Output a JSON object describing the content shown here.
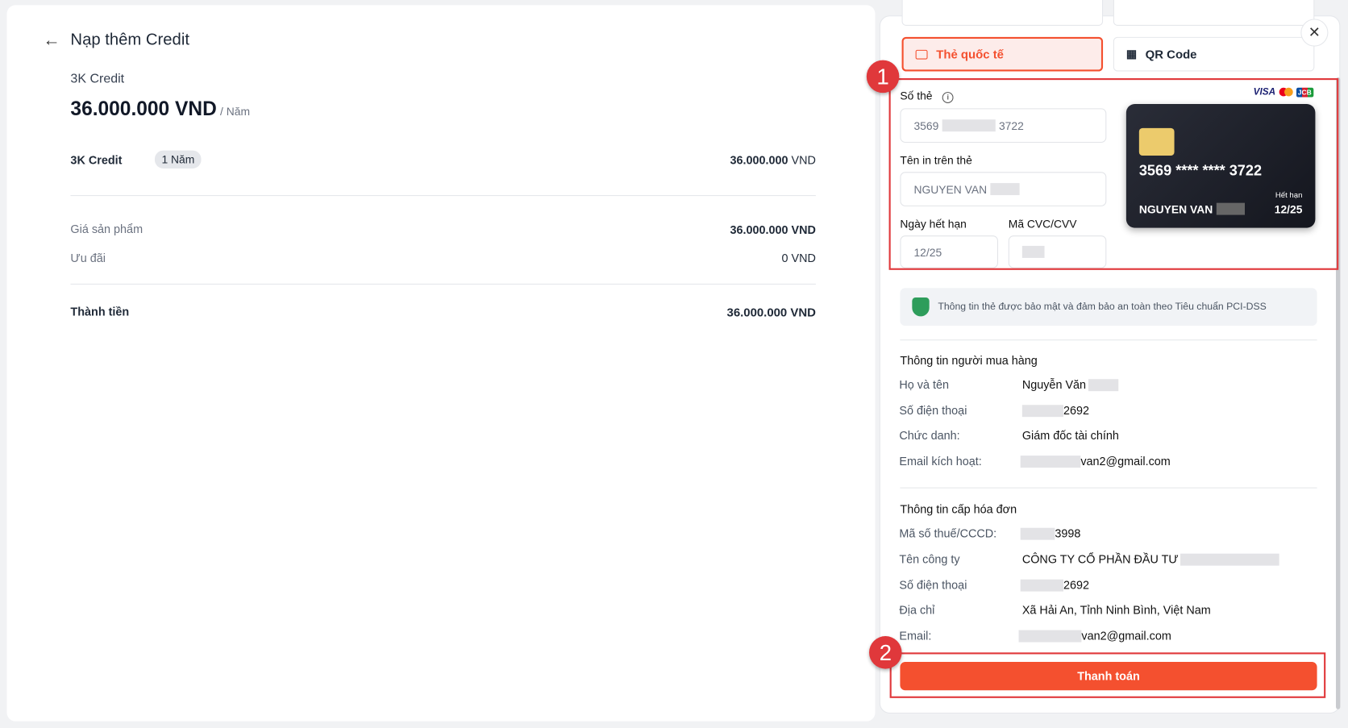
{
  "header": {
    "title": "Nạp thêm Credit"
  },
  "product": {
    "name": "3K Credit",
    "price": "36.000.000 VND",
    "period": "/ Năm"
  },
  "line_item": {
    "name": "3K Credit",
    "duration": "1 Năm",
    "amount": "36.000.000",
    "currency": "VND"
  },
  "summary": {
    "product_price_label": "Giá sản phẩm",
    "product_price": "36.000.000 VND",
    "discount_label": "Ưu đãi",
    "discount": "0 VND",
    "total_label": "Thành tiền",
    "total": "36.000.000 VND"
  },
  "payment": {
    "tabs": [
      {
        "label": "Thẻ quốc tế",
        "active": true
      },
      {
        "label": "QR Code",
        "active": false
      }
    ],
    "card_number_label": "Số thẻ",
    "card_number_start": "3569",
    "card_number_end": "3722",
    "name_label": "Tên in trên thẻ",
    "name_value": "NGUYEN VAN",
    "expiry_label": "Ngày hết hạn",
    "expiry_value": "12/25",
    "cvc_label": "Mã CVC/CVV",
    "brands": [
      "VISA",
      "mastercard",
      "JCB"
    ],
    "card_preview": {
      "number": "3569 **** **** 3722",
      "holder": "NGUYEN VAN",
      "expiry_label": "Hết hạn",
      "expiry": "12/25"
    },
    "security_note": "Thông tin thẻ được bảo mật và đảm bảo an toàn theo Tiêu chuẩn PCI-DSS"
  },
  "buyer": {
    "title": "Thông tin người mua hàng",
    "rows": [
      {
        "label": "Họ và tên",
        "value": "Nguyễn Văn"
      },
      {
        "label": "Số điện thoại",
        "value": "2692"
      },
      {
        "label": "Chức danh:",
        "value": "Giám đốc tài chính"
      },
      {
        "label": "Email kích hoạt:",
        "value": "van2@gmail.com"
      }
    ]
  },
  "invoice": {
    "title": "Thông tin cấp hóa đơn",
    "rows": [
      {
        "label": "Mã số thuế/CCCD:",
        "value": "3998"
      },
      {
        "label": "Tên công ty",
        "value": "CÔNG TY CỔ PHẦN ĐẦU TƯ"
      },
      {
        "label": "Số điện thoại",
        "value": "2692"
      },
      {
        "label": "Địa chỉ",
        "value": "Xã Hải An, Tỉnh Ninh Bình, Việt Nam"
      },
      {
        "label": "Email:",
        "value": "van2@gmail.com"
      }
    ]
  },
  "pay_button": "Thanh toán",
  "annotations": [
    "1",
    "2"
  ],
  "colors": {
    "accent": "#f4502f",
    "annotation": "#e0383b"
  }
}
